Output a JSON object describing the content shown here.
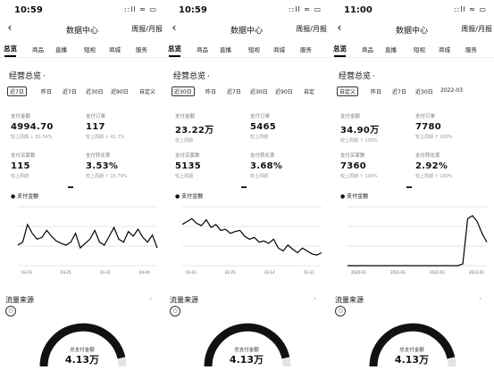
{
  "panels": [
    {
      "status_time": "10:59",
      "status_icons": "::ll ≈ ▭",
      "title": "数据中心",
      "period_label": "周报/月报",
      "tabs": [
        "总览",
        "商品",
        "直播",
        "短视",
        "商城",
        "服务"
      ],
      "section_title": "经营总览",
      "filters": [
        "近7日",
        "昨日",
        "近7日",
        "近30日",
        "近90日",
        "自定义"
      ],
      "metrics": [
        {
          "label": "支付金额",
          "value": "4994.70",
          "sub": "较上周期 ↓ 50.34%"
        },
        {
          "label": "支付订单",
          "value": "117",
          "sub": "较上周期 ↓ 41.7%"
        },
        {
          "label": "支付买家数",
          "value": "115",
          "sub": "较上周期"
        },
        {
          "label": "支付转化率",
          "value": "3.53%",
          "sub": "较上周期 ↑ 15.79%"
        }
      ],
      "chart_legend": "支付金额",
      "chart_data": {
        "type": "line",
        "x": [
          1,
          2,
          3,
          4,
          5,
          6,
          7,
          8,
          9,
          10,
          11,
          12,
          13,
          14,
          15,
          16,
          17,
          18,
          19,
          20,
          21,
          22,
          23,
          24,
          25,
          26,
          27,
          28,
          29,
          30
        ],
        "values": [
          35,
          40,
          70,
          55,
          45,
          48,
          60,
          50,
          42,
          38,
          35,
          40,
          55,
          30,
          38,
          45,
          60,
          40,
          35,
          50,
          65,
          45,
          40,
          58,
          50,
          62,
          48,
          40,
          52,
          30
        ],
        "ylim": [
          0,
          100
        ],
        "x_ticks": [
          "03-19",
          "03-25",
          "03-31",
          "04-06"
        ]
      },
      "traffic_title": "流量来源",
      "gauge_label": "总支付金额",
      "gauge_value": "4.13万",
      "gauge_fraction": 0.93
    },
    {
      "status_time": "10:59",
      "status_icons": "::ll ≈ ▭",
      "title": "数据中心",
      "period_label": "周报/月报",
      "tabs": [
        "总览",
        "商品",
        "直播",
        "短视",
        "商城",
        "服务"
      ],
      "section_title": "经营总览",
      "filters": [
        "近30日",
        "昨日",
        "近7日",
        "近30日",
        "近90日",
        "自定"
      ],
      "metrics": [
        {
          "label": "支付金额",
          "value": "23.22万",
          "sub": "较上周期"
        },
        {
          "label": "支付订单",
          "value": "5465",
          "sub": "较上周期"
        },
        {
          "label": "支付买家数",
          "value": "5135",
          "sub": "较上周期"
        },
        {
          "label": "支付转化率",
          "value": "3.68%",
          "sub": "较上周期"
        }
      ],
      "chart_legend": "支付金额",
      "chart_data": {
        "type": "line",
        "x": [
          1,
          2,
          3,
          4,
          5,
          6,
          7,
          8,
          9,
          10,
          11,
          12,
          13,
          14,
          15,
          16,
          17,
          18,
          19,
          20,
          21,
          22,
          23,
          24,
          25,
          26,
          27,
          28,
          29,
          30
        ],
        "values": [
          70,
          75,
          80,
          72,
          68,
          78,
          65,
          70,
          60,
          62,
          55,
          58,
          60,
          50,
          45,
          48,
          40,
          42,
          38,
          45,
          30,
          25,
          35,
          28,
          22,
          30,
          25,
          20,
          18,
          22
        ],
        "ylim": [
          0,
          100
        ],
        "x_ticks": [
          "02-03",
          "02-25",
          "03-14",
          "03-31"
        ]
      },
      "traffic_title": "流量来源",
      "gauge_label": "总支付金额",
      "gauge_value": "4.13万",
      "gauge_fraction": 0.93
    },
    {
      "status_time": "11:00",
      "status_icons": "::ll ≈ ▭",
      "title": "数据中心",
      "period_label": "周报/月报",
      "tabs": [
        "总览",
        "商品",
        "直播",
        "短视",
        "商城",
        "服务"
      ],
      "section_title": "经营总览",
      "filters": [
        "自定义",
        "昨日",
        "近7日",
        "近30日",
        "2022-03"
      ],
      "metrics": [
        {
          "label": "支付金额",
          "value": "34.90万",
          "sub": "较上周期 ↑ 100%"
        },
        {
          "label": "支付订单",
          "value": "7780",
          "sub": "较上周期 ↑ 100%"
        },
        {
          "label": "支付买家数",
          "value": "7360",
          "sub": "较上周期 ↑ 100%"
        },
        {
          "label": "支付转化率",
          "value": "2.92%",
          "sub": "较上周期 ↑ 100%"
        }
      ],
      "chart_legend": "支付金额",
      "chart_data": {
        "type": "line",
        "x": [
          1,
          2,
          3,
          4,
          5,
          6,
          7,
          8,
          9,
          10,
          11,
          12,
          13,
          14,
          15,
          16,
          17,
          18,
          19,
          20,
          21,
          22,
          23,
          24,
          25,
          26,
          27,
          28,
          29,
          30
        ],
        "values": [
          0,
          0,
          0,
          0,
          0,
          0,
          0,
          0,
          0,
          0,
          0,
          0,
          0,
          0,
          0,
          0,
          0,
          0,
          0,
          0,
          0,
          0,
          0,
          0,
          3,
          80,
          85,
          75,
          55,
          40
        ],
        "ylim": [
          0,
          100
        ],
        "x_ticks": [
          "2020-03",
          "2021-03",
          "2022-03",
          "2023-03"
        ]
      },
      "traffic_title": "流量来源",
      "gauge_label": "总支付金额",
      "gauge_value": "4.13万",
      "gauge_fraction": 0.93
    }
  ]
}
